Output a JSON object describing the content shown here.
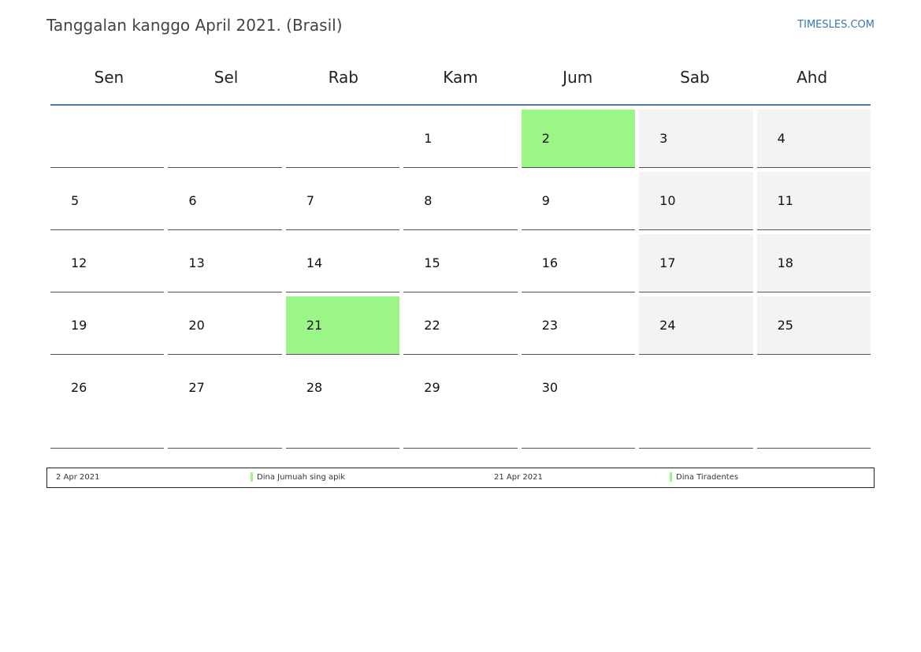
{
  "header": {
    "title": "Tanggalan kanggo April 2021. (Brasil)",
    "site": "TIMESLES.COM"
  },
  "calendar": {
    "weekdays": [
      "Sen",
      "Sel",
      "Rab",
      "Kam",
      "Jum",
      "Sab",
      "Ahd"
    ],
    "weeks": [
      [
        "",
        "",
        "",
        "1",
        "2",
        "3",
        "4"
      ],
      [
        "5",
        "6",
        "7",
        "8",
        "9",
        "10",
        "11"
      ],
      [
        "12",
        "13",
        "14",
        "15",
        "16",
        "17",
        "18"
      ],
      [
        "19",
        "20",
        "21",
        "22",
        "23",
        "24",
        "25"
      ],
      [
        "26",
        "27",
        "28",
        "29",
        "30",
        "",
        ""
      ]
    ],
    "holiday_color": "#9cf587",
    "weekend_color": "#f3f3f3"
  },
  "legend": {
    "items": [
      {
        "date": "2 Apr 2021",
        "name": "Dina Jumuah sing apik"
      },
      {
        "date": "21 Apr 2021",
        "name": "Dina Tiradentes"
      }
    ]
  }
}
